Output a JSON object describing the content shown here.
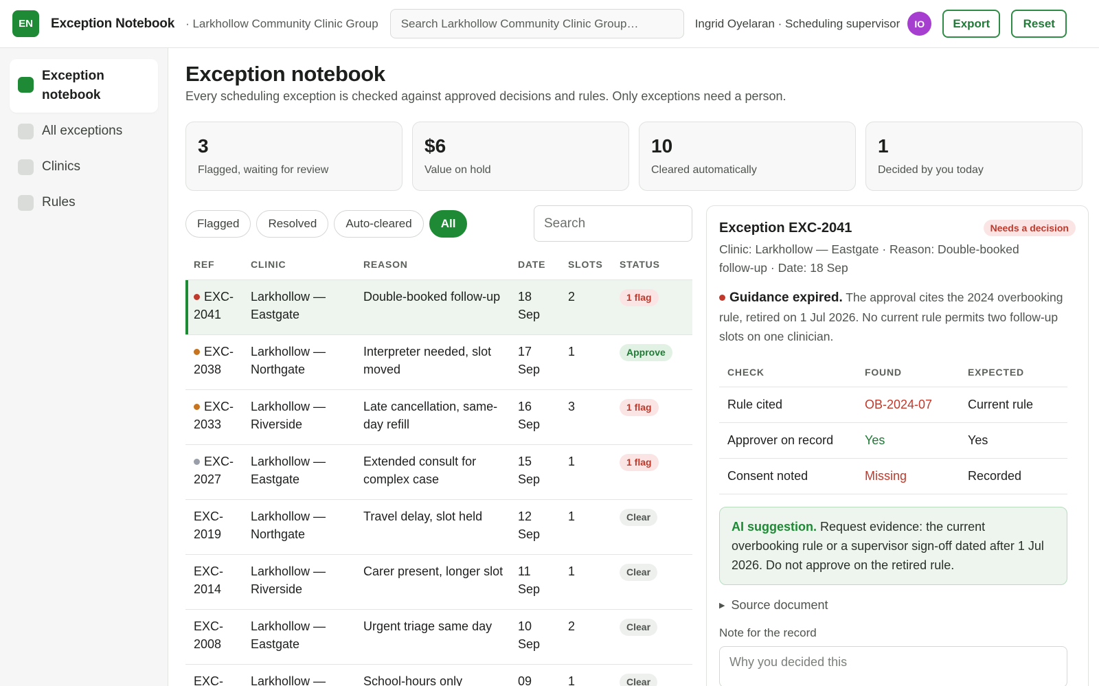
{
  "header": {
    "logo_text": "EN",
    "app_title": "Exception Notebook",
    "org_name": "· Larkhollow Community Clinic Group",
    "search_placeholder": "Search Larkhollow Community Clinic Group…",
    "user": "Ingrid Oyelaran · Scheduling supervisor",
    "avatar_initials": "IO",
    "export_label": "Export",
    "reset_label": "Reset"
  },
  "sidebar": {
    "items": [
      {
        "label": "Exception notebook",
        "active": true
      },
      {
        "label": "All exceptions"
      },
      {
        "label": "Clinics"
      },
      {
        "label": "Rules"
      }
    ]
  },
  "main": {
    "title": "Exception notebook",
    "subtitle": "Every scheduling exception is checked against approved decisions and rules. Only exceptions need a person.",
    "stats": [
      {
        "value": "3",
        "label": "Flagged, waiting for review"
      },
      {
        "value": "$6",
        "label": "Value on hold"
      },
      {
        "value": "10",
        "label": "Cleared automatically"
      },
      {
        "value": "1",
        "label": "Decided by you today"
      }
    ],
    "filters": [
      {
        "label": "Flagged"
      },
      {
        "label": "Resolved"
      },
      {
        "label": "Auto-cleared"
      },
      {
        "label": "All",
        "active": true
      }
    ],
    "search_placeholder": "Search"
  },
  "table": {
    "headers": {
      "ref": "REF",
      "clinic": "CLINIC",
      "reason": "REASON",
      "date": "DATE",
      "slots": "SLOTS",
      "status": "STATUS"
    },
    "rows": [
      {
        "ref": "EXC-2041",
        "clinic": "Larkhollow — Eastgate",
        "reason": "Double-booked follow-up",
        "date": "18 Sep",
        "slots": "2",
        "status": "1 flag"
      },
      {
        "ref": "EXC-2038",
        "clinic": "Larkhollow — Northgate",
        "reason": "Interpreter needed, slot moved",
        "date": "17 Sep",
        "slots": "1",
        "status": "Approve"
      },
      {
        "ref": "EXC-2033",
        "clinic": "Larkhollow — Riverside",
        "reason": "Late cancellation, same-day refill",
        "date": "16 Sep",
        "slots": "3",
        "status": "1 flag"
      },
      {
        "ref": "EXC-2027",
        "clinic": "Larkhollow — Eastgate",
        "reason": "Extended consult for complex case",
        "date": "15 Sep",
        "slots": "1",
        "status": "1 flag"
      },
      {
        "ref": "EXC-2019",
        "clinic": "Larkhollow — Northgate",
        "reason": "Travel delay, slot held",
        "date": "12 Sep",
        "slots": "1",
        "status": "Clear"
      },
      {
        "ref": "EXC-2014",
        "clinic": "Larkhollow — Riverside",
        "reason": "Carer present, longer slot",
        "date": "11 Sep",
        "slots": "1",
        "status": "Clear"
      },
      {
        "ref": "EXC-2008",
        "clinic": "Larkhollow — Eastgate",
        "reason": "Urgent triage same day",
        "date": "10 Sep",
        "slots": "2",
        "status": "Clear"
      },
      {
        "ref": "EXC-",
        "clinic": "Larkhollow —",
        "reason": "School-hours only",
        "date": "09",
        "slots": "1",
        "status": "Clear"
      }
    ]
  },
  "detail": {
    "title": "Exception EXC-2041",
    "badge": "Needs a decision",
    "meta": "Clinic: Larkhollow — Eastgate · Reason: Double-booked follow-up · Date: 18 Sep",
    "guidance_title": "Guidance expired.",
    "guidance_text": " The approval cites the 2024 overbooking rule, retired on 1 Jul 2026. No current rule permits two follow-up slots on one clinician.",
    "check_headers": {
      "check": "CHECK",
      "found": "FOUND",
      "expected": "EXPECTED"
    },
    "checks": [
      {
        "check": "Rule cited",
        "found": "OB-2024-07",
        "expected": "Current rule"
      },
      {
        "check": "Approver on record",
        "found": "Yes",
        "expected": "Yes"
      },
      {
        "check": "Consent noted",
        "found": "Missing",
        "expected": "Recorded"
      }
    ],
    "ai_title": "AI suggestion.",
    "ai_text": " Request evidence: the current overbooking rule or a supervisor sign-off dated after 1 Jul 2026. Do not approve on the retired rule.",
    "source_label": "Source document",
    "note_label": "Note for the record",
    "note_placeholder": "Why you decided this"
  },
  "colors": {
    "accent": "#1f8a35",
    "flag_red": "#c0392b",
    "dot_red": "#c0392b",
    "dot_orange": "#c8731e",
    "dot_grey": "#9a9ea8"
  }
}
